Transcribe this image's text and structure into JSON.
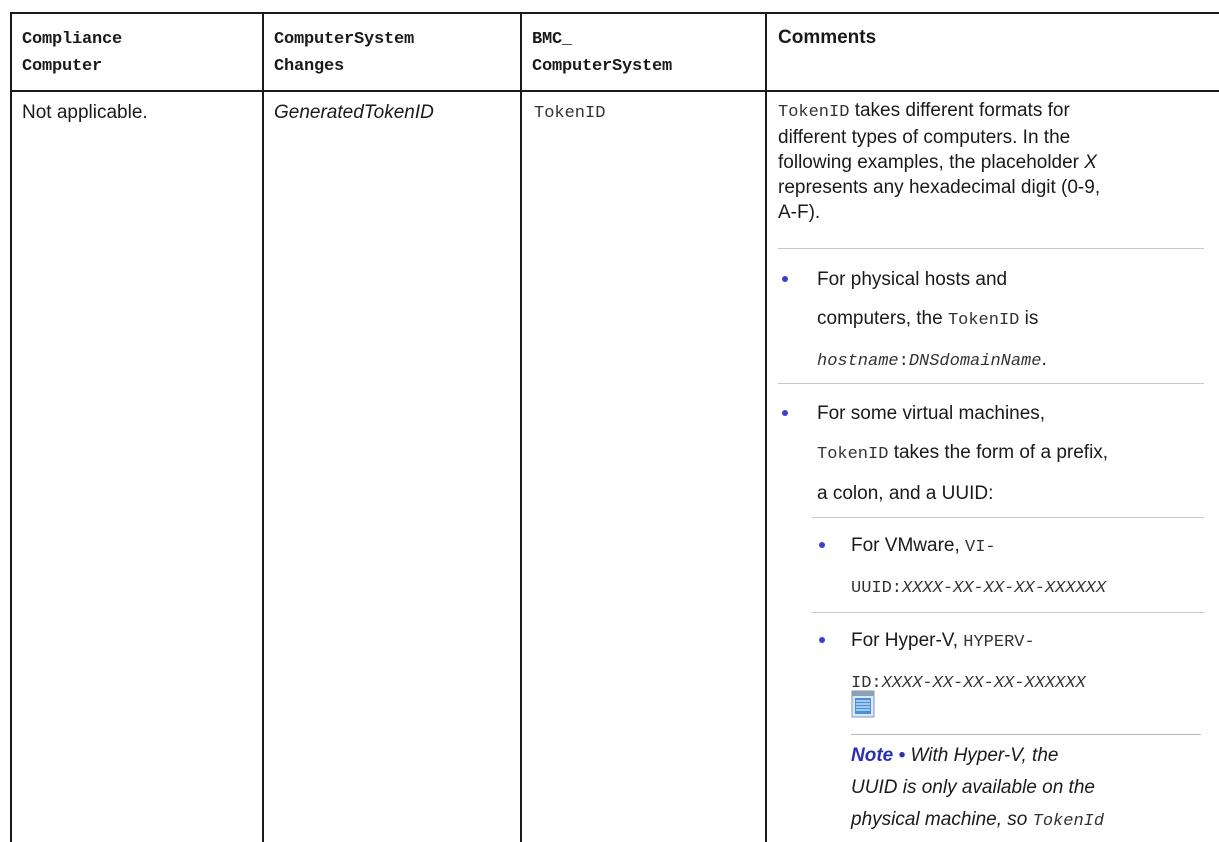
{
  "table": {
    "headers": [
      "Compliance\nComputer",
      "ComputerSystem\nChanges",
      "BMC_\nComputerSystem",
      "Comments"
    ],
    "row": {
      "col1": "Not applicable.",
      "col2": "GeneratedTokenID",
      "col3": "TokenID"
    }
  },
  "comments": {
    "intro_code": "TokenID",
    "intro_line1": " takes different formats for",
    "intro_line2": "different types of computers. In the",
    "intro_line3a": "following examples, the placeholder ",
    "intro_line3b": "X",
    "intro_line4": "represents any hexadecimal digit (0-9,",
    "intro_line5": "A-F).",
    "b1_line1": "For physical hosts and",
    "b1_line2a": "computers, the ",
    "b1_code": "TokenID",
    "b1_line2b": " is",
    "b1_line3a": "hostname",
    "b1_line3b": ":",
    "b1_line3c": "DNSdomainName",
    "b1_line3d": ".",
    "b2_line1": "For some virtual machines,",
    "b2_code": "TokenID",
    "b2_line2": " takes the form of a prefix,",
    "b2_line3": "a colon, and a UUID:",
    "s1_line1": "For VMware, ",
    "s1_code1": "VI-",
    "s1_code2": "UUID:",
    "s1_code3": "XXXX-XX-XX-XX-XXXXXX",
    "s2_line1": "For Hyper-V, ",
    "s2_code1": "HYPERV-",
    "s2_code2": "ID:",
    "s2_code3": "XXXX-XX-XX-XX-XXXXXX",
    "note_label": "Note",
    "note_bullet": " • ",
    "note_line1": "With Hyper-V, the",
    "note_line2": "UUID is only available on the",
    "note_line3": "physical machine, so ",
    "note_code": "TokenId"
  },
  "icons": {
    "note": "note-icon"
  },
  "colors": {
    "bullet": "#3b3fd0",
    "note_label": "#2b2fb3"
  }
}
